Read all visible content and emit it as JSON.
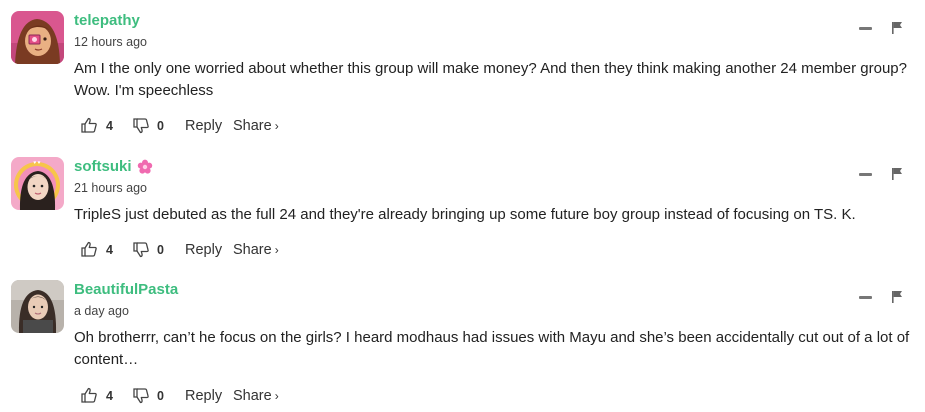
{
  "comments": [
    {
      "username": "telepathy",
      "time": "12 hours ago",
      "text": "Am I the only one worried about whether this group will make money? And then they think making another 24 member group? Wow. I'm speechless",
      "likes": "4",
      "dislikes": "0",
      "reply_label": "Reply",
      "share_label": "Share",
      "avatar_icon": "pink-anime-avatar"
    },
    {
      "username": "softsuki",
      "time": "21 hours ago",
      "text": "TripleS just debuted as the full 24 and they're already bringing up some future boy group instead of focusing on TS. K.",
      "likes": "4",
      "dislikes": "0",
      "reply_label": "Reply",
      "share_label": "Share",
      "badge_icon": "pink-flower-icon",
      "avatar_icon": "pink-photo-avatar"
    },
    {
      "username": "BeautifulPasta",
      "time": "a day ago",
      "text": "Oh brotherrr, can’t he focus on the girls? I heard modhaus had issues with Mayu and she’s been accidentally cut out of a lot of content…",
      "likes": "4",
      "dislikes": "0",
      "reply_label": "Reply",
      "share_label": "Share",
      "avatar_icon": "photo-avatar"
    }
  ],
  "colors": {
    "username": "#3ebd7f",
    "text": "#222222",
    "muted": "#444444",
    "flower": "#f06ab0"
  }
}
